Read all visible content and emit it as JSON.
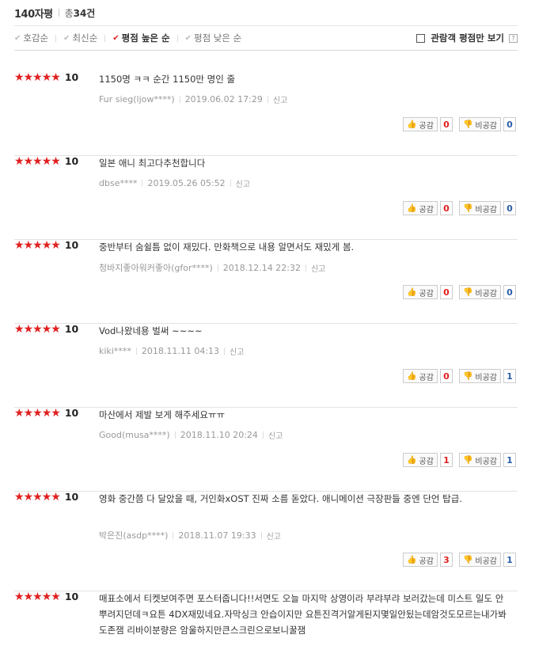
{
  "header": {
    "title": "140자평",
    "count_prefix": "총",
    "count_value": "34건"
  },
  "sort": {
    "items": [
      {
        "label": "호감순",
        "active": false
      },
      {
        "label": "최신순",
        "active": false
      },
      {
        "label": "평점 높은 순",
        "active": true
      },
      {
        "label": "평점 낮은 순",
        "active": false
      }
    ],
    "check_glyph": "✔",
    "filter_label": "관람객 평점만 보기",
    "help_label": "?"
  },
  "labels": {
    "like": "공감",
    "dislike": "비공감",
    "report": "신고",
    "star": "★"
  },
  "reviews": [
    {
      "score": "10",
      "text": "1150명 ㅋㅋ 순간 1150만 명인 줄",
      "author": "Fur sieg(ljow****)",
      "date": "2019.06.02 17:29",
      "likes": "0",
      "dislikes": "0",
      "rating": 5
    },
    {
      "score": "10",
      "text": "일본 애니 최고다추천합니다",
      "author": "dbse****",
      "date": "2019.05.26 05:52",
      "likes": "0",
      "dislikes": "0",
      "rating": 5
    },
    {
      "score": "10",
      "text": "중반부터 숨쉴틈 없이 재밌다. 만화책으로 내용 알면서도 재밌게 봄.",
      "author": "청바지좋아워커좋아(gfor****)",
      "date": "2018.12.14 22:32",
      "likes": "0",
      "dislikes": "0",
      "rating": 5
    },
    {
      "score": "10",
      "text": "Vod나왔네용 벌써 ~~~~",
      "author": "kiki****",
      "date": "2018.11.11 04:13",
      "likes": "0",
      "dislikes": "1",
      "rating": 5
    },
    {
      "score": "10",
      "text": "마산에서 제발 보게 해주세요ㅠㅠ",
      "author": "Good(musa****)",
      "date": "2018.11.10 20:24",
      "likes": "1",
      "dislikes": "1",
      "rating": 5
    },
    {
      "score": "10",
      "text": "영화 중간쯤 다 달았을 때, 거인화xOST 진짜 소름 돋았다. 애니메이션 극장판들 중엔 단언 탑급.",
      "author": "박은진(asdp****)",
      "date": "2018.11.07 19:33",
      "likes": "3",
      "dislikes": "1",
      "rating": 5
    },
    {
      "score": "10",
      "text": "매표소에서 티켓보여주면 포스터줍니다!!서면도 오늘 마지막 상영이라 부랴부랴 보러갔는데 미스트 일도 안뿌려지던데ㅋ요튼 4DX재밌네요.자막싱크 안습이지만 요튼진격거알게된지몇일안됬는데암것도모르는내가봐도존잼 리바이분량은 암울하지만큰스크린으로보니꿀잼",
      "author": "",
      "date": "",
      "likes": "",
      "dislikes": "",
      "rating": 5
    }
  ]
}
